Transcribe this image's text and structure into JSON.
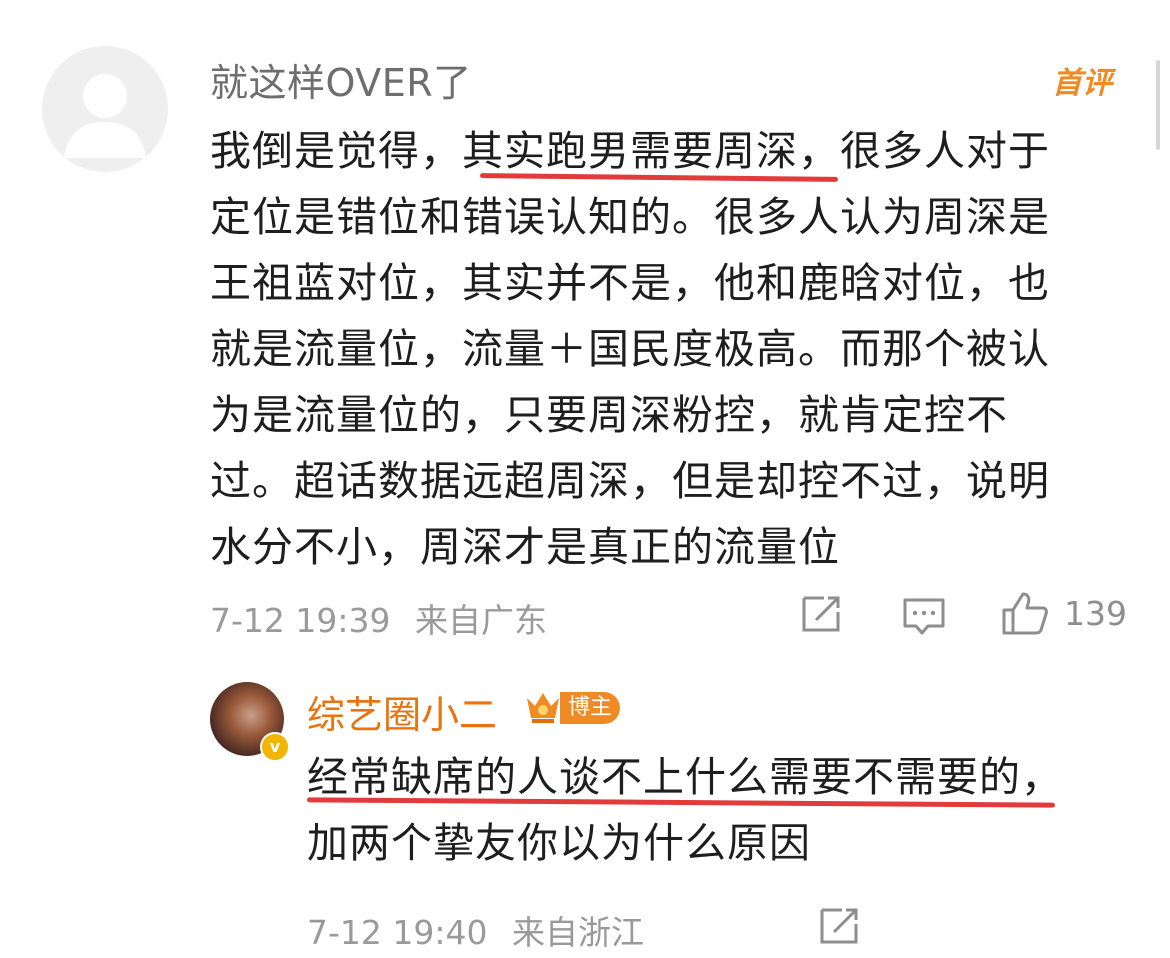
{
  "main_comment": {
    "username": "就这样OVER了",
    "badge": "首评",
    "body_lines": [
      "我倒是觉得，其实跑男需要周深，很多人对于",
      "定位是错位和错误认知的。很多人认为周深是",
      "王祖蓝对位，其实并不是，他和鹿晗对位，也",
      "就是流量位，流量＋国民度极高。而那个被认",
      "为是流量位的，只要周深粉控，就肯定控不",
      "过。超话数据远超周深，但是却控不过，说明",
      "水分不小，周深才是真正的流量位"
    ],
    "timestamp": "7-12 19:39",
    "location": "来自广东",
    "like_count": "139"
  },
  "reply": {
    "username": "综艺圈小二",
    "badge": "博主",
    "body_lines": [
      "经常缺席的人谈不上什么需要不需要的，",
      "加两个挚友你以为什么原因"
    ],
    "timestamp": "7-12 19:40",
    "location": "来自浙江"
  },
  "colors": {
    "accent_orange": "#f08a24",
    "underline_red": "#e23b3b",
    "meta_gray": "#9a9a9a"
  },
  "icons": [
    "repost-icon",
    "comment-icon",
    "like-icon",
    "crown-icon",
    "verified-icon"
  ]
}
